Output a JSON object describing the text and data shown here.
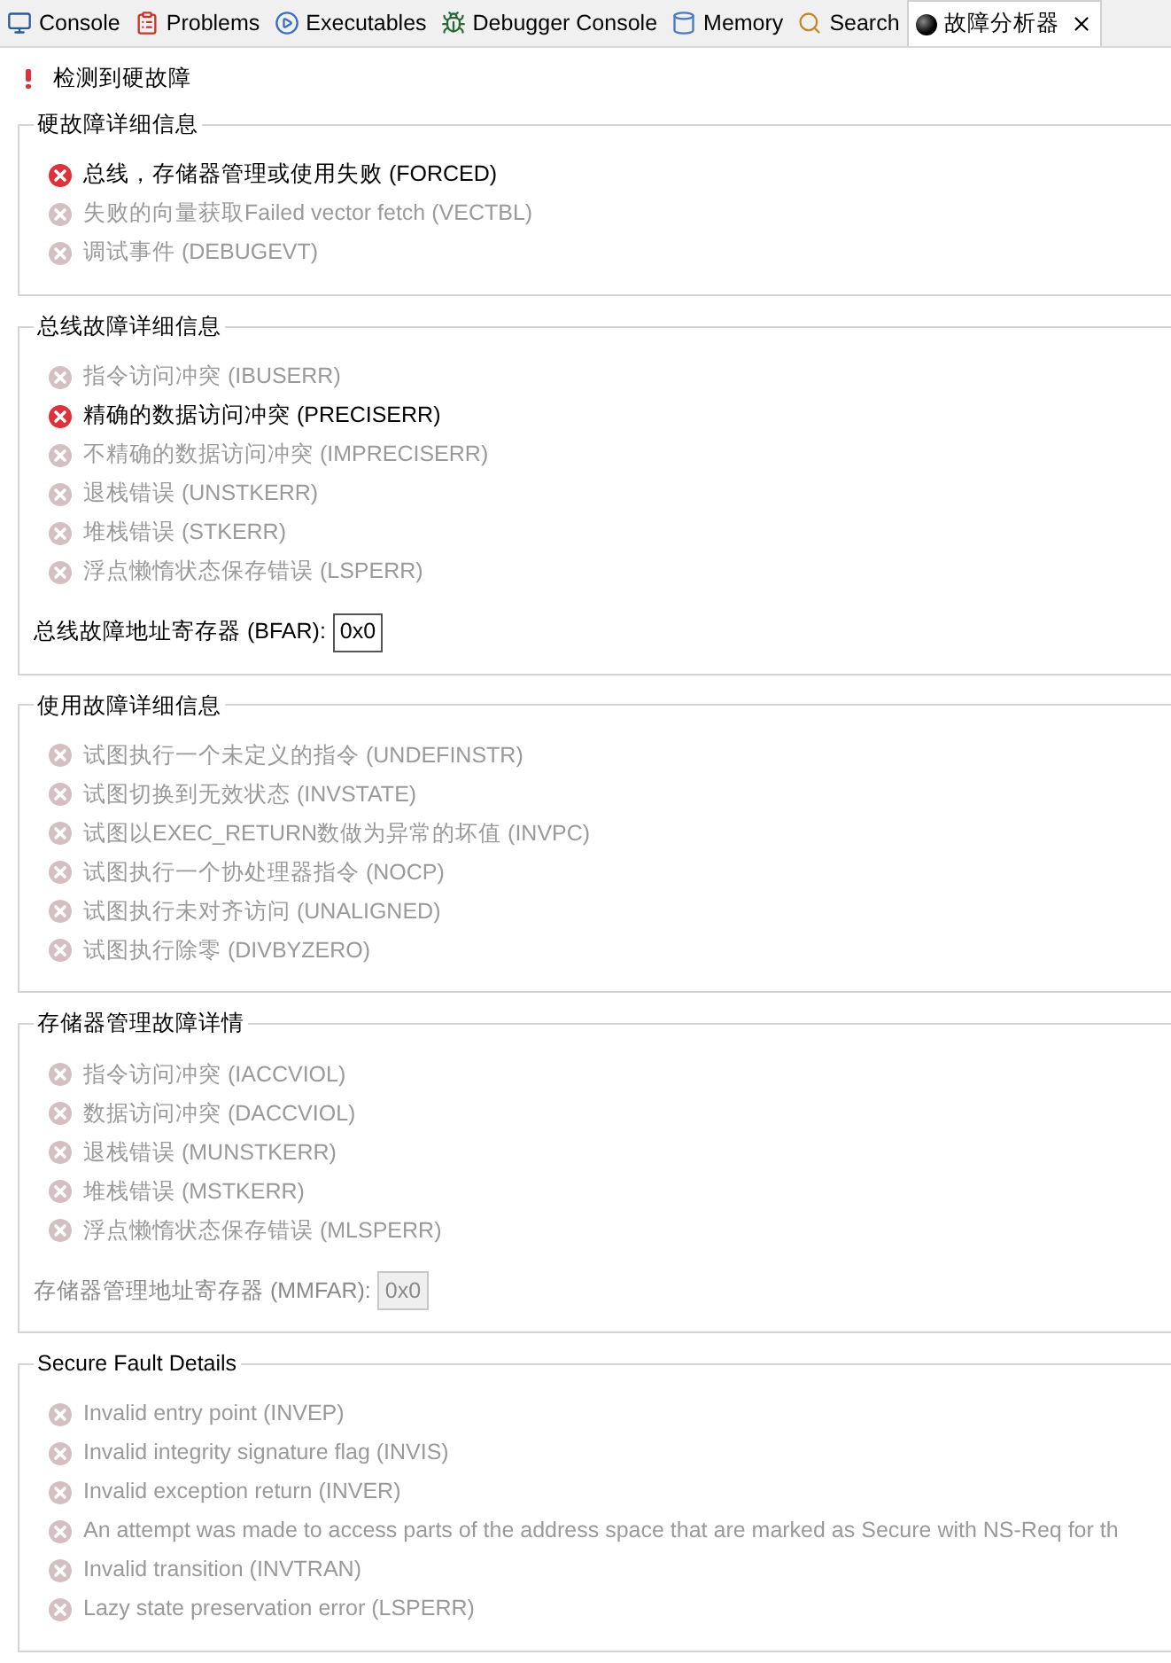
{
  "tabs": [
    {
      "label": "Console",
      "kind": "console",
      "selected": false
    },
    {
      "label": "Problems",
      "kind": "problems",
      "selected": false
    },
    {
      "label": "Executables",
      "kind": "executables",
      "selected": false
    },
    {
      "label": "Debugger Console",
      "kind": "debugger",
      "selected": false
    },
    {
      "label": "Memory",
      "kind": "memory",
      "selected": false
    },
    {
      "label": "Search",
      "kind": "search",
      "selected": false
    },
    {
      "label": "故障分析器",
      "kind": "fault",
      "selected": true,
      "closable": true
    }
  ],
  "status": {
    "text": "检测到硬故障"
  },
  "groups": [
    {
      "title": "硬故障详细信息",
      "items": [
        {
          "text": "总线，存储器管理或使用失败 (FORCED)",
          "active": true
        },
        {
          "text": "失败的向量获取Failed vector fetch (VECTBL)",
          "active": false
        },
        {
          "text": "调试事件 (DEBUGEVT)",
          "active": false
        }
      ]
    },
    {
      "title": "总线故障详细信息",
      "items": [
        {
          "text": "指令访问冲突 (IBUSERR)",
          "active": false
        },
        {
          "text": "精确的数据访问冲突 (PRECISERR)",
          "active": true
        },
        {
          "text": "不精确的数据访问冲突 (IMPRECISERR)",
          "active": false
        },
        {
          "text": "退栈错误 (UNSTKERR)",
          "active": false
        },
        {
          "text": "堆栈错误 (STKERR)",
          "active": false
        },
        {
          "text": "浮点懒惰状态保存错误 (LSPERR)",
          "active": false
        }
      ],
      "register": {
        "label": "总线故障地址寄存器 (BFAR):",
        "value": "0x0",
        "disabled": false
      }
    },
    {
      "title": "使用故障详细信息",
      "items": [
        {
          "text": "试图执行一个未定义的指令 (UNDEFINSTR)",
          "active": false
        },
        {
          "text": "试图切换到无效状态 (INVSTATE)",
          "active": false
        },
        {
          "text": "试图以EXEC_RETURN数做为异常的坏值 (INVPC)",
          "active": false
        },
        {
          "text": "试图执行一个协处理器指令 (NOCP)",
          "active": false
        },
        {
          "text": "试图执行未对齐访问 (UNALIGNED)",
          "active": false
        },
        {
          "text": "试图执行除零 (DIVBYZERO)",
          "active": false
        }
      ]
    },
    {
      "title": "存储器管理故障详情",
      "items": [
        {
          "text": "指令访问冲突 (IACCVIOL)",
          "active": false
        },
        {
          "text": "数据访问冲突 (DACCVIOL)",
          "active": false
        },
        {
          "text": "退栈错误 (MUNSTKERR)",
          "active": false
        },
        {
          "text": "堆栈错误 (MSTKERR)",
          "active": false
        },
        {
          "text": "浮点懒惰状态保存错误 (MLSPERR)",
          "active": false
        }
      ],
      "register": {
        "label": "存储器管理地址寄存器 (MMFAR):",
        "value": "0x0",
        "disabled": true
      }
    },
    {
      "title": "Secure Fault Details",
      "items": [
        {
          "text": "Invalid entry point (INVEP)",
          "active": false
        },
        {
          "text": "Invalid integrity signature flag (INVIS)",
          "active": false
        },
        {
          "text": "Invalid exception return (INVER)",
          "active": false
        },
        {
          "text": "An attempt was made to access parts of the address space that are marked as Secure with NS-Req for th",
          "active": false
        },
        {
          "text": "Invalid transition (INVTRAN)",
          "active": false
        },
        {
          "text": "Lazy state preservation error (LSPERR)",
          "active": false
        }
      ]
    }
  ]
}
